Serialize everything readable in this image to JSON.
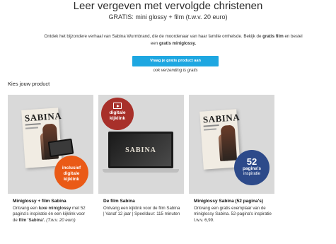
{
  "header": {
    "title": "Leer vergeven met vervolgde christenen",
    "subtitle": "GRATIS: mini glossy + film (t.w.v. 20 euro)"
  },
  "intro": {
    "part1": "Ontdek het bijzondere verhaal van Sabina Wurmbrand, die de moordenaar van haar familie omhelsde. Bekijk de ",
    "bold1": "gratis film",
    "part2": " en bestel een ",
    "bold2": "gratis miniglossy.",
    "cta_label": "Vraag je gratis product aan",
    "shipping_note": "ook verzending is gratis"
  },
  "section_title": "Kies jouw product",
  "products": [
    {
      "magazine_title": "SABINA",
      "badge": "inclusief digitale kijklink",
      "title": "Miniglossy + film Sabina",
      "desc_part1": "Ontvang een ",
      "desc_bold1": "luxe miniglossy",
      "desc_part2": " met 52 pagina's inspiratie én een kijklink voor de ",
      "desc_bold2": "film 'Sabina'.",
      "desc_italic": " (T.w.v. 20 euro)"
    },
    {
      "video_title": "SABINA",
      "badge": "digitale kijklink",
      "title": "De film Sabina",
      "desc": "Ontvang een kijklink voor de film Sabina | Vanaf 12 jaar | Speelduur: 115 minuten"
    },
    {
      "magazine_title": "SABINA",
      "badge_number": "52",
      "badge_line1": "pagina's",
      "badge_line2": "inspiratie",
      "title": "Miniglossy Sabina (52 pagina's)",
      "desc": "Ontvang een gratis exemplaar van de miniglossy Sabina. 52-pagina's inspiratie t.w.v. 6,99."
    }
  ],
  "colors": {
    "cta": "#1ea7e1",
    "badge_orange": "#ea5a16",
    "badge_red": "#a8302a",
    "badge_navy": "#2d4a8a"
  }
}
